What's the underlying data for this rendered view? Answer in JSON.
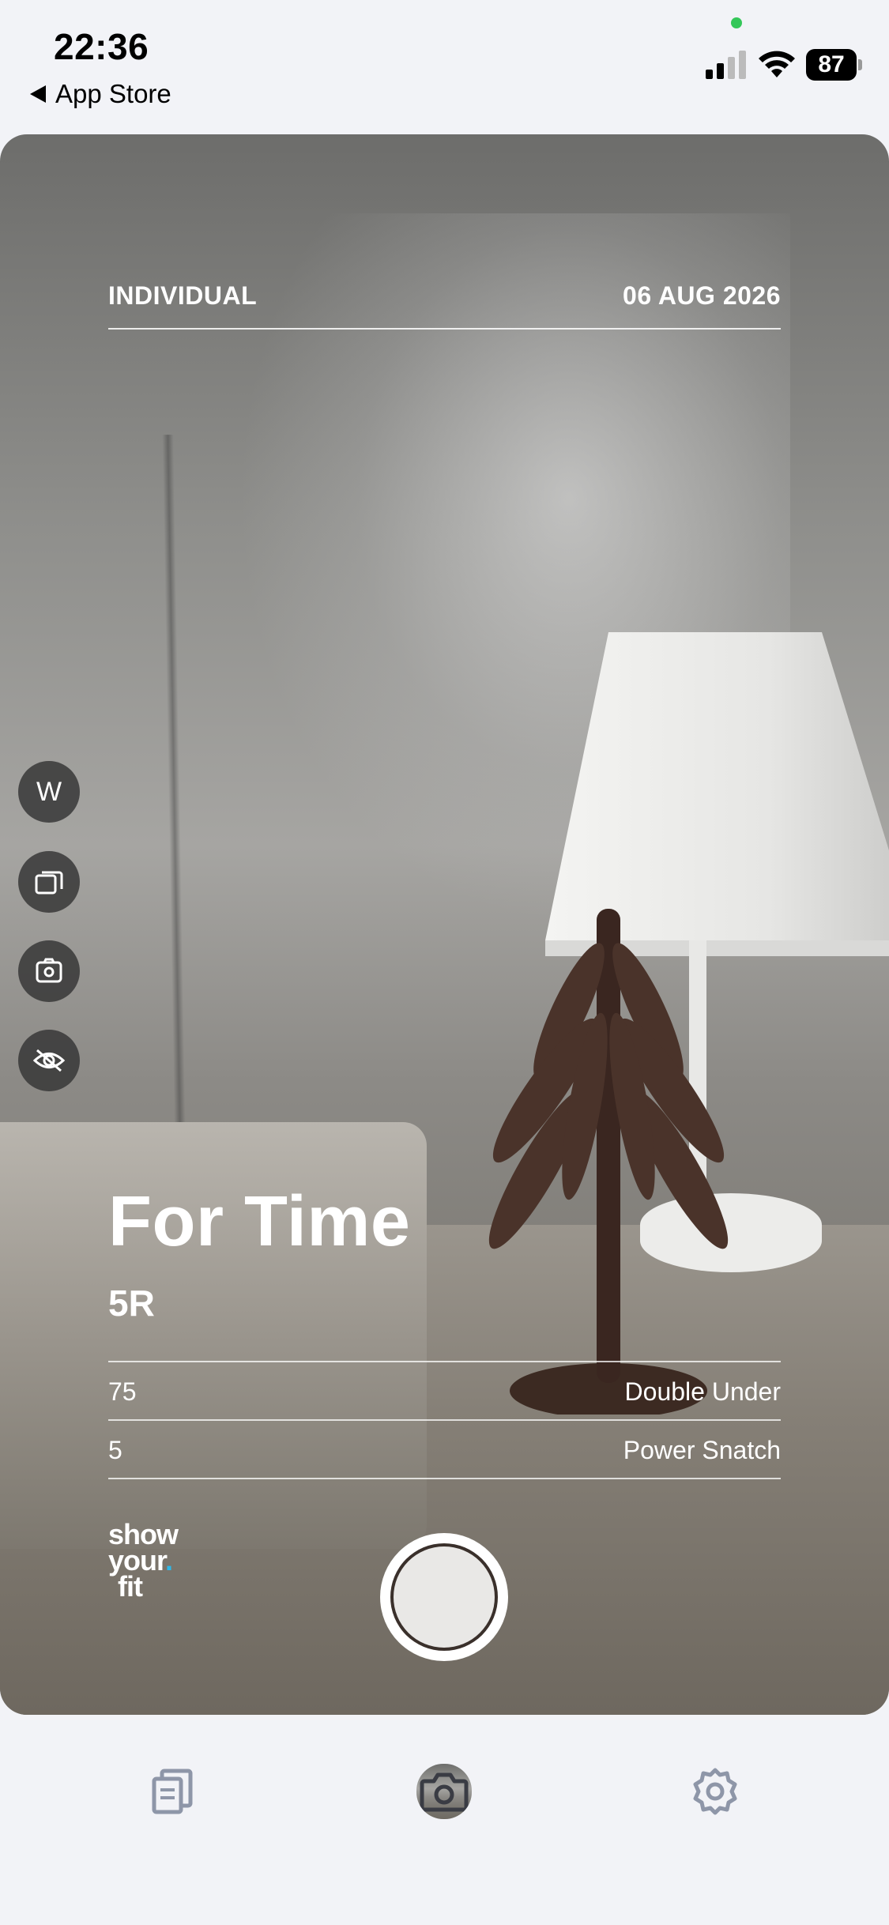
{
  "status_bar": {
    "time": "22:36",
    "back_label": "App Store",
    "battery": "87"
  },
  "overlay": {
    "category": "INDIVIDUAL",
    "date": "06 AUG 2026",
    "workout_type": "For Time",
    "rounds": "5R",
    "exercises": [
      {
        "reps": "75",
        "name": "Double Under"
      },
      {
        "reps": "5",
        "name": "Power Snatch"
      }
    ]
  },
  "side_controls": {
    "weight_unit": "W",
    "icons": [
      "gallery-icon",
      "flip-camera-icon",
      "hide-eye-icon"
    ]
  },
  "brand": {
    "line1": "show",
    "line2": "your",
    "dot": ".",
    "line3": "fit",
    "dot_color": "#2fb7e8"
  },
  "tabbar": {
    "items": [
      "records-icon",
      "camera-icon",
      "settings-icon"
    ],
    "active": "camera-icon"
  }
}
